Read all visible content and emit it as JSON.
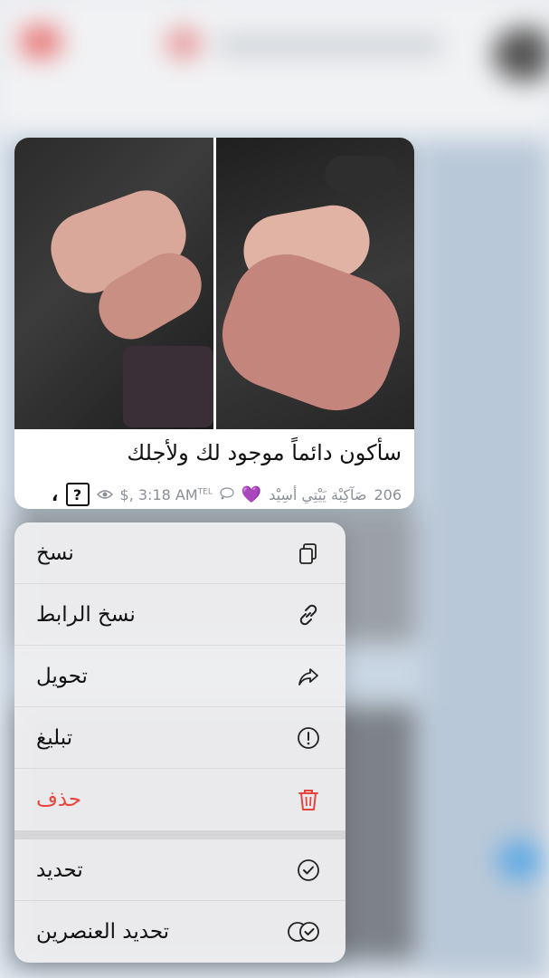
{
  "message": {
    "text": "سأكون دائماً موجود لك ولأجلك",
    "views": "206",
    "reaction_name": "صَآكِبْة يَيْتِي أسِيْد",
    "reaction_heart": "💜",
    "status": "$, 3:18 AM",
    "status_sup": "TEL",
    "unread_marker": "?",
    "comma": "،"
  },
  "menu": {
    "items": [
      {
        "label": "نسخ",
        "icon": "copy-icon"
      },
      {
        "label": "نسخ الرابط",
        "icon": "link-icon"
      },
      {
        "label": "تحويل",
        "icon": "forward-icon"
      },
      {
        "label": "تبليغ",
        "icon": "report-icon"
      },
      {
        "label": "حذف",
        "icon": "trash-icon",
        "color": "#e8433a"
      },
      {
        "label": "تحديد",
        "icon": "checkmark-circle-icon"
      },
      {
        "label": "تحديد العنصرين",
        "icon": "double-check-circle-icon"
      }
    ]
  }
}
